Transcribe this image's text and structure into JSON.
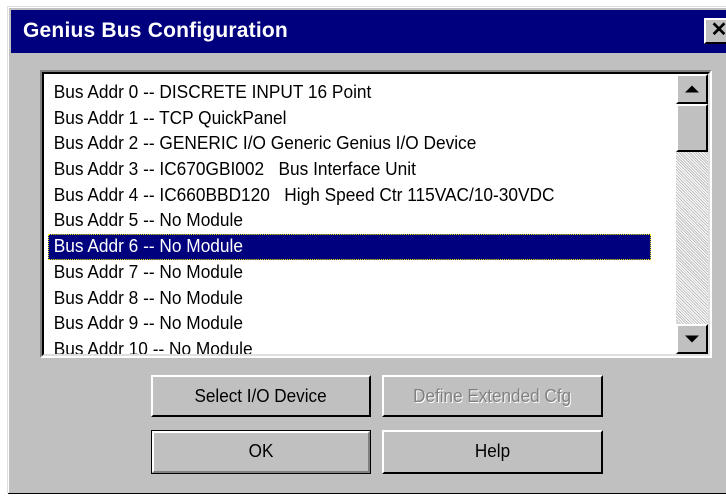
{
  "dialog": {
    "title": "Genius Bus Configuration",
    "close_glyph": "✕"
  },
  "listbox": {
    "items": [
      "Bus Addr 0 -- DISCRETE INPUT 16 Point",
      "Bus Addr 1 -- TCP QuickPanel",
      "Bus Addr 2 -- GENERIC I/O Generic Genius I/O Device",
      "Bus Addr 3 -- IC670GBI002   Bus Interface Unit",
      "Bus Addr 4 -- IC660BBD120   High Speed Ctr 115VAC/10-30VDC",
      "Bus Addr 5 -- No Module",
      "Bus Addr 6 -- No Module",
      "Bus Addr 7 -- No Module",
      "Bus Addr 8 -- No Module",
      "Bus Addr 9 -- No Module",
      "Bus Addr 10 -- No Module"
    ],
    "selected_index": 6
  },
  "buttons": {
    "select_io": "Select I/O Device",
    "define_ext": "Define Extended Cfg",
    "ok": "OK",
    "help": "Help"
  },
  "colors": {
    "title_bg": "#00007f",
    "face": "#c0c0c0",
    "selection": "#00007f"
  }
}
